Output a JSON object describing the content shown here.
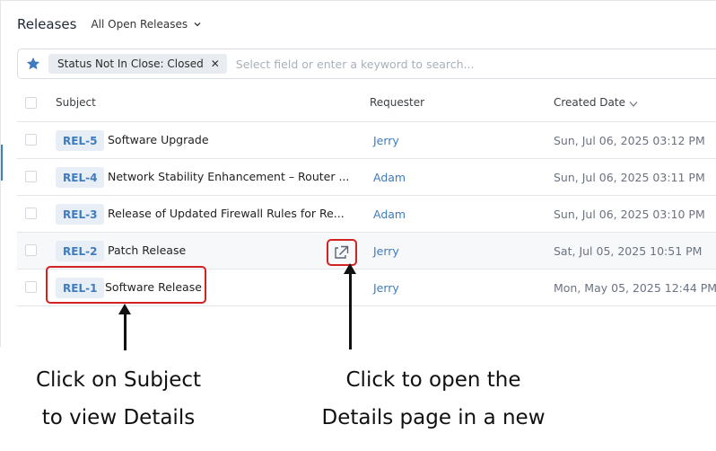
{
  "header": {
    "title": "Releases",
    "view": "All Open Releases"
  },
  "filter": {
    "chip": "Status Not In Close: Closed",
    "placeholder": "Select field or enter a keyword to search..."
  },
  "columns": {
    "subject": "Subject",
    "requester": "Requester",
    "created": "Created Date"
  },
  "rows": [
    {
      "id": "REL-5",
      "subject": "Software Upgrade",
      "requester": "Jerry",
      "created": "Sun, Jul 06, 2025 03:12 PM"
    },
    {
      "id": "REL-4",
      "subject": "Network Stability Enhancement – Router ...",
      "requester": "Adam",
      "created": "Sun, Jul 06, 2025 03:11 PM"
    },
    {
      "id": "REL-3",
      "subject": "Release of Updated Firewall Rules for Re...",
      "requester": "Adam",
      "created": "Sun, Jul 06, 2025 03:10 PM"
    },
    {
      "id": "REL-2",
      "subject": "Patch Release",
      "requester": "Jerry",
      "created": "Sat, Jul 05, 2025 10:51 PM"
    },
    {
      "id": "REL-1",
      "subject": "Software Release",
      "requester": "Jerry",
      "created": "Mon, May 05, 2025 12:44 PM"
    }
  ],
  "annotations": {
    "left": {
      "line1": "Click on Subject",
      "line2": "to view Details"
    },
    "right": {
      "line1": "Click to open the",
      "line2": "Details page in a new"
    }
  },
  "colors": {
    "accent": "#3e7bbf",
    "callout": "#d32222"
  },
  "icons": {
    "favorite": "star-icon",
    "view_toggle": "chevron-down-icon",
    "sort": "sort-down-icon",
    "open_new": "external-link-icon"
  }
}
